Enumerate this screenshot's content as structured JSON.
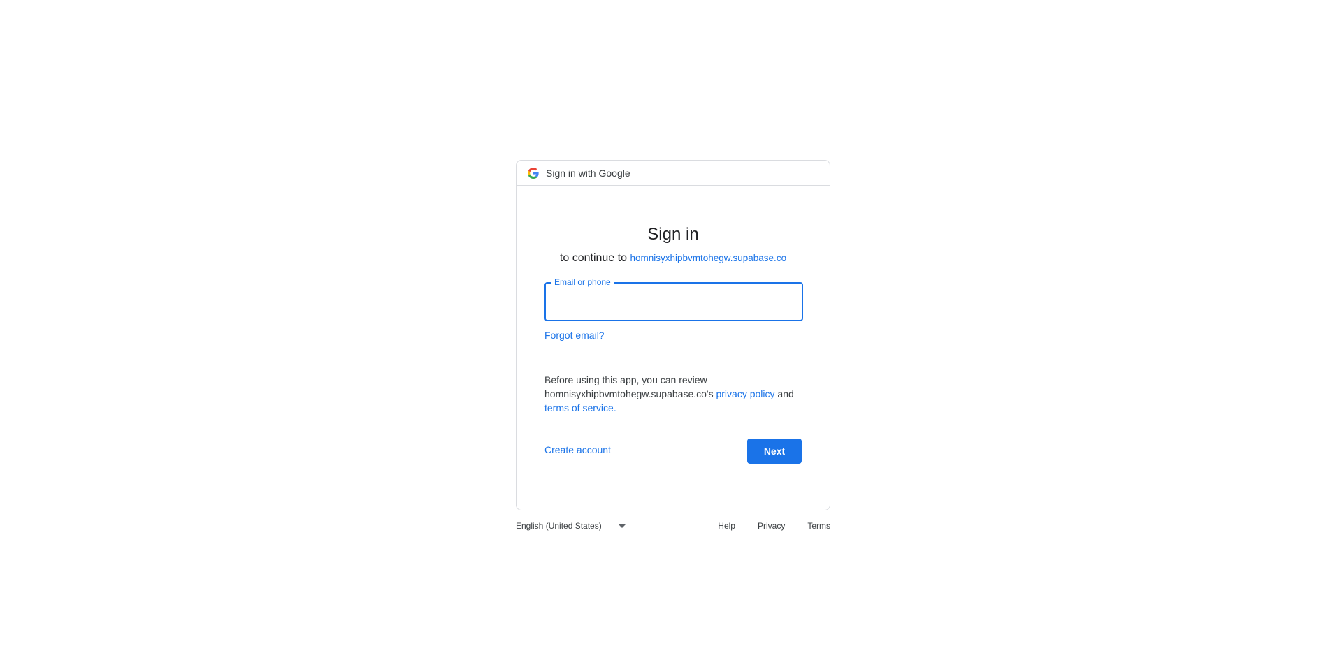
{
  "header": {
    "title": "Sign in with Google"
  },
  "main": {
    "title": "Sign in",
    "subtitle_prefix": "to continue to",
    "domain": "homnisyxhipbvmtohegw.supabase.co",
    "email_field": {
      "label": "Email or phone",
      "value": ""
    },
    "forgot_email": "Forgot email?",
    "notice": {
      "line1": "Before using this app, you can review",
      "domain_possessive": "homnisyxhipbvmtohegw.supabase.co's",
      "privacy_link": "privacy policy",
      "and": "and",
      "terms_link": "terms of service",
      "period": "."
    },
    "create_account": "Create account",
    "next": "Next"
  },
  "footer": {
    "language": "English (United States)",
    "links": [
      "Help",
      "Privacy",
      "Terms"
    ]
  },
  "colors": {
    "accent": "#1a73e8",
    "border": "#dadce0",
    "text": "#202124"
  },
  "icons": {
    "logo": "google-g-icon",
    "dropdown": "caret-down-icon"
  }
}
